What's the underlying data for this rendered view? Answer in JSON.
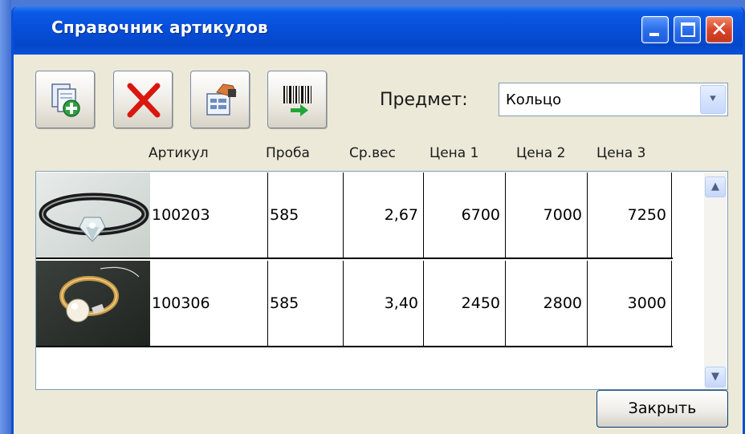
{
  "window": {
    "title": "Справочник артикулов"
  },
  "toolbar": {
    "buttons": [
      {
        "icon": "add-document-icon"
      },
      {
        "icon": "delete-icon"
      },
      {
        "icon": "edit-icon"
      },
      {
        "icon": "barcode-icon"
      }
    ]
  },
  "subject": {
    "label": "Предмет:",
    "value": "Кольцо"
  },
  "table": {
    "headers": [
      "Артикул",
      "Проба",
      "Ср.вес",
      "Цена 1",
      "Цена 2",
      "Цена 3"
    ],
    "rows": [
      {
        "image": "ring-diamond-photo",
        "article": "100203",
        "proba": "585",
        "weight": "2,67",
        "price1": "6700",
        "price2": "7000",
        "price3": "7250"
      },
      {
        "image": "ring-pearl-photo",
        "article": "100306",
        "proba": "585",
        "weight": "3,40",
        "price1": "2450",
        "price2": "2800",
        "price3": "3000"
      }
    ]
  },
  "buttons": {
    "close_label": "Закрыть"
  },
  "colors": {
    "titlebar": "#0750dc",
    "window_bg": "#ece9d8",
    "close_red": "#d9462a"
  }
}
